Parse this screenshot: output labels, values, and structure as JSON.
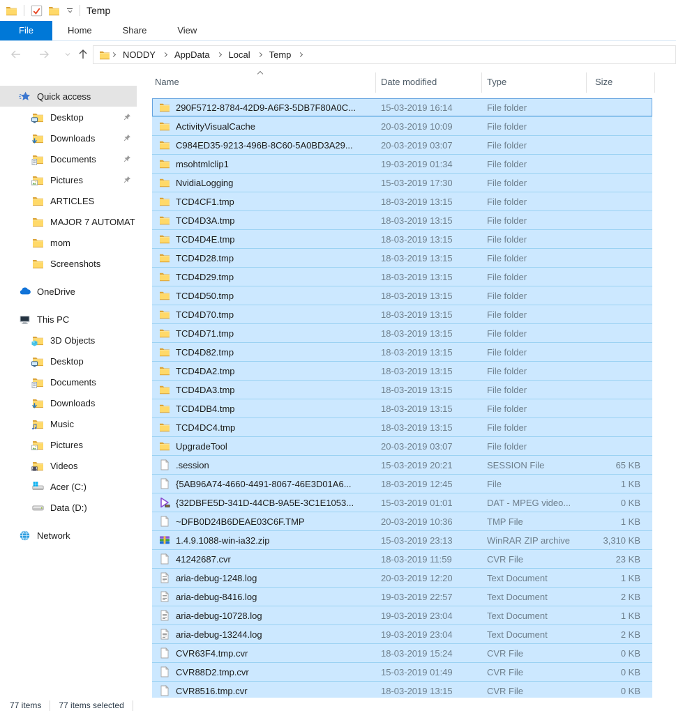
{
  "titlebar": {
    "title": "Temp",
    "icons": [
      "folder-icon",
      "checkmark-icon",
      "folder-icon",
      "customize-toolbar-caret"
    ]
  },
  "ribbon": {
    "tabs": [
      {
        "label": "File",
        "active": true
      },
      {
        "label": "Home",
        "active": false
      },
      {
        "label": "Share",
        "active": false
      },
      {
        "label": "View",
        "active": false
      }
    ]
  },
  "navbar": {
    "crumbs": [
      "NODDY",
      "AppData",
      "Local",
      "Temp"
    ]
  },
  "sidebar": {
    "items": [
      {
        "label": "Quick access",
        "icon": "quick-access-star",
        "level": 0,
        "selected": true,
        "gap": false,
        "pinned": false
      },
      {
        "label": "Desktop",
        "icon": "folder-desktop",
        "level": 1,
        "pinned": true,
        "gap": false
      },
      {
        "label": "Downloads",
        "icon": "folder-downloads",
        "level": 1,
        "pinned": true,
        "gap": false
      },
      {
        "label": "Documents",
        "icon": "folder-documents",
        "level": 1,
        "pinned": true,
        "gap": false
      },
      {
        "label": "Pictures",
        "icon": "folder-pictures",
        "level": 1,
        "pinned": true,
        "gap": false
      },
      {
        "label": "ARTICLES",
        "icon": "folder",
        "level": 1,
        "pinned": false,
        "gap": false
      },
      {
        "label": "MAJOR 7 AUTOMAT",
        "icon": "folder",
        "level": 1,
        "pinned": false,
        "gap": false
      },
      {
        "label": "mom",
        "icon": "folder",
        "level": 1,
        "pinned": false,
        "gap": false
      },
      {
        "label": "Screenshots",
        "icon": "folder",
        "level": 1,
        "pinned": false,
        "gap": false
      },
      {
        "label": "OneDrive",
        "icon": "onedrive-cloud",
        "level": 0,
        "pinned": false,
        "gap": true
      },
      {
        "label": "This PC",
        "icon": "this-pc",
        "level": 0,
        "pinned": false,
        "gap": true
      },
      {
        "label": "3D Objects",
        "icon": "folder-3d",
        "level": 1,
        "pinned": false,
        "gap": false
      },
      {
        "label": "Desktop",
        "icon": "folder-desktop",
        "level": 1,
        "pinned": false,
        "gap": false
      },
      {
        "label": "Documents",
        "icon": "folder-documents",
        "level": 1,
        "pinned": false,
        "gap": false
      },
      {
        "label": "Downloads",
        "icon": "folder-downloads",
        "level": 1,
        "pinned": false,
        "gap": false
      },
      {
        "label": "Music",
        "icon": "folder-music",
        "level": 1,
        "pinned": false,
        "gap": false
      },
      {
        "label": "Pictures",
        "icon": "folder-pictures",
        "level": 1,
        "pinned": false,
        "gap": false
      },
      {
        "label": "Videos",
        "icon": "folder-videos",
        "level": 1,
        "pinned": false,
        "gap": false
      },
      {
        "label": "Acer (C:)",
        "icon": "drive-os",
        "level": 1,
        "pinned": false,
        "gap": false
      },
      {
        "label": "Data (D:)",
        "icon": "drive",
        "level": 1,
        "pinned": false,
        "gap": false
      },
      {
        "label": "Network",
        "icon": "network",
        "level": 0,
        "pinned": false,
        "gap": true
      }
    ]
  },
  "list": {
    "columns": [
      "Name",
      "Date modified",
      "Type",
      "Size"
    ],
    "sort": {
      "column": "Name",
      "ascending": true
    },
    "rows": [
      {
        "name": "290F5712-8784-42D9-A6F3-5DB7F80A0C...",
        "date": "15-03-2019 16:14",
        "type": "File folder",
        "size": "",
        "icon": "folder"
      },
      {
        "name": "ActivityVisualCache",
        "date": "20-03-2019 10:09",
        "type": "File folder",
        "size": "",
        "icon": "folder"
      },
      {
        "name": "C984ED35-9213-496B-8C60-5A0BD3A29...",
        "date": "20-03-2019 03:07",
        "type": "File folder",
        "size": "",
        "icon": "folder"
      },
      {
        "name": "msohtmlclip1",
        "date": "19-03-2019 01:34",
        "type": "File folder",
        "size": "",
        "icon": "folder"
      },
      {
        "name": "NvidiaLogging",
        "date": "15-03-2019 17:30",
        "type": "File folder",
        "size": "",
        "icon": "folder"
      },
      {
        "name": "TCD4CF1.tmp",
        "date": "18-03-2019 13:15",
        "type": "File folder",
        "size": "",
        "icon": "folder"
      },
      {
        "name": "TCD4D3A.tmp",
        "date": "18-03-2019 13:15",
        "type": "File folder",
        "size": "",
        "icon": "folder"
      },
      {
        "name": "TCD4D4E.tmp",
        "date": "18-03-2019 13:15",
        "type": "File folder",
        "size": "",
        "icon": "folder"
      },
      {
        "name": "TCD4D28.tmp",
        "date": "18-03-2019 13:15",
        "type": "File folder",
        "size": "",
        "icon": "folder"
      },
      {
        "name": "TCD4D29.tmp",
        "date": "18-03-2019 13:15",
        "type": "File folder",
        "size": "",
        "icon": "folder"
      },
      {
        "name": "TCD4D50.tmp",
        "date": "18-03-2019 13:15",
        "type": "File folder",
        "size": "",
        "icon": "folder"
      },
      {
        "name": "TCD4D70.tmp",
        "date": "18-03-2019 13:15",
        "type": "File folder",
        "size": "",
        "icon": "folder"
      },
      {
        "name": "TCD4D71.tmp",
        "date": "18-03-2019 13:15",
        "type": "File folder",
        "size": "",
        "icon": "folder"
      },
      {
        "name": "TCD4D82.tmp",
        "date": "18-03-2019 13:15",
        "type": "File folder",
        "size": "",
        "icon": "folder"
      },
      {
        "name": "TCD4DA2.tmp",
        "date": "18-03-2019 13:15",
        "type": "File folder",
        "size": "",
        "icon": "folder"
      },
      {
        "name": "TCD4DA3.tmp",
        "date": "18-03-2019 13:15",
        "type": "File folder",
        "size": "",
        "icon": "folder"
      },
      {
        "name": "TCD4DB4.tmp",
        "date": "18-03-2019 13:15",
        "type": "File folder",
        "size": "",
        "icon": "folder"
      },
      {
        "name": "TCD4DC4.tmp",
        "date": "18-03-2019 13:15",
        "type": "File folder",
        "size": "",
        "icon": "folder"
      },
      {
        "name": "UpgradeTool",
        "date": "20-03-2019 03:07",
        "type": "File folder",
        "size": "",
        "icon": "folder"
      },
      {
        "name": ".session",
        "date": "15-03-2019 20:21",
        "type": "SESSION File",
        "size": "65 KB",
        "icon": "file"
      },
      {
        "name": "{5AB96A74-4660-4491-8067-46E3D01A6...",
        "date": "18-03-2019 12:45",
        "type": "File",
        "size": "1 KB",
        "icon": "file"
      },
      {
        "name": "{32DBFE5D-341D-44CB-9A5E-3C1E1053...",
        "date": "15-03-2019 01:01",
        "type": "DAT - MPEG video...",
        "size": "0 KB",
        "icon": "media"
      },
      {
        "name": "~DFB0D24B6DEAE03C6F.TMP",
        "date": "20-03-2019 10:36",
        "type": "TMP File",
        "size": "1 KB",
        "icon": "file"
      },
      {
        "name": "1.4.9.1088-win-ia32.zip",
        "date": "15-03-2019 23:13",
        "type": "WinRAR ZIP archive",
        "size": "3,310 KB",
        "icon": "winrar"
      },
      {
        "name": "41242687.cvr",
        "date": "18-03-2019 11:59",
        "type": "CVR File",
        "size": "23 KB",
        "icon": "file"
      },
      {
        "name": "aria-debug-1248.log",
        "date": "20-03-2019 12:20",
        "type": "Text Document",
        "size": "1 KB",
        "icon": "textdoc"
      },
      {
        "name": "aria-debug-8416.log",
        "date": "19-03-2019 22:57",
        "type": "Text Document",
        "size": "2 KB",
        "icon": "textdoc"
      },
      {
        "name": "aria-debug-10728.log",
        "date": "19-03-2019 23:04",
        "type": "Text Document",
        "size": "1 KB",
        "icon": "textdoc"
      },
      {
        "name": "aria-debug-13244.log",
        "date": "19-03-2019 23:04",
        "type": "Text Document",
        "size": "2 KB",
        "icon": "textdoc"
      },
      {
        "name": "CVR63F4.tmp.cvr",
        "date": "18-03-2019 15:24",
        "type": "CVR File",
        "size": "0 KB",
        "icon": "file"
      },
      {
        "name": "CVR88D2.tmp.cvr",
        "date": "15-03-2019 01:49",
        "type": "CVR File",
        "size": "0 KB",
        "icon": "file"
      },
      {
        "name": "CVR8516.tmp.cvr",
        "date": "18-03-2019 13:15",
        "type": "CVR File",
        "size": "0 KB",
        "icon": "file"
      }
    ]
  },
  "statusbar": {
    "items_count": "77 items",
    "selected_count": "77 items selected"
  },
  "colors": {
    "accent": "#0078d7",
    "selection_bg": "#cce8ff",
    "selection_border": "#99d1ff",
    "focus_border": "#66a3e0"
  }
}
